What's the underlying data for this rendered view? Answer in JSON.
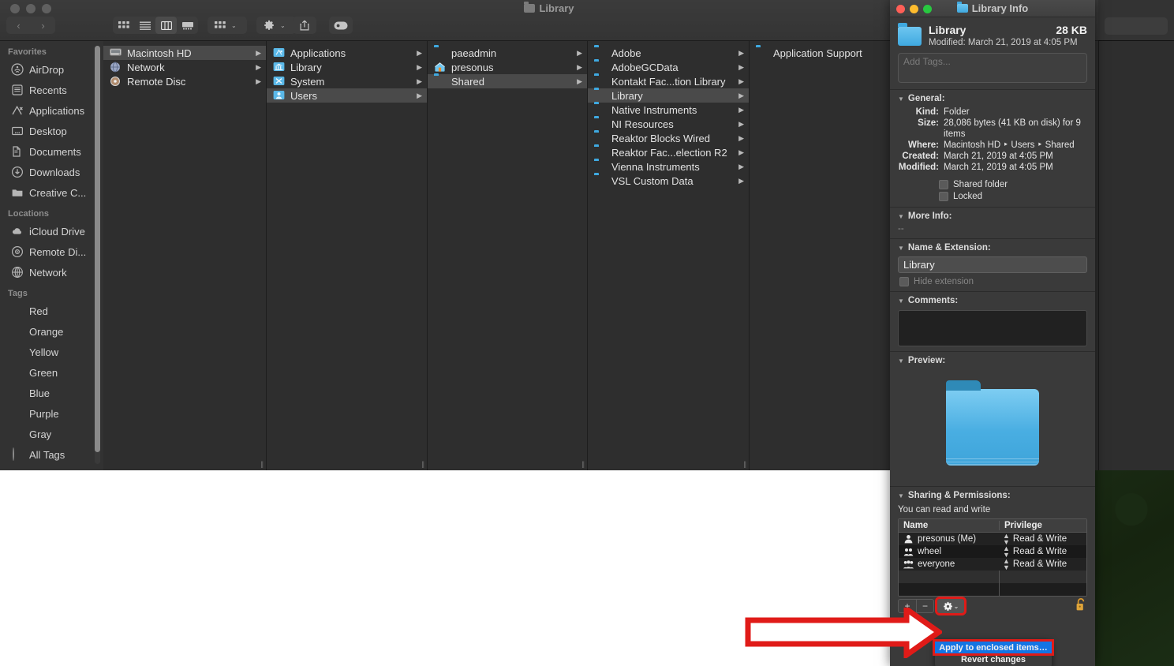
{
  "finder_window": {
    "title": "Library",
    "title_icon": "folder-icon",
    "toolbar": {
      "back_label": "‹",
      "forward_label": "›",
      "view_icon_label": "icon-view-icon",
      "view_list_label": "list-view-icon",
      "view_column_label": "column-view-icon",
      "view_gallery_label": "gallery-view-icon",
      "group_label": "group-by-icon",
      "action_label": "gear-icon",
      "share_label": "share-icon",
      "tags_label": "tag-icon",
      "chevron": "⌄"
    },
    "sidebar": {
      "sections": [
        {
          "header": "Favorites",
          "items": [
            {
              "label": "AirDrop",
              "icon": "airdrop-icon"
            },
            {
              "label": "Recents",
              "icon": "recents-icon"
            },
            {
              "label": "Applications",
              "icon": "applications-icon"
            },
            {
              "label": "Desktop",
              "icon": "desktop-icon"
            },
            {
              "label": "Documents",
              "icon": "documents-icon"
            },
            {
              "label": "Downloads",
              "icon": "downloads-icon"
            },
            {
              "label": "Creative C...",
              "icon": "folder-icon"
            }
          ]
        },
        {
          "header": "Locations",
          "items": [
            {
              "label": "iCloud Drive",
              "icon": "cloud-icon"
            },
            {
              "label": "Remote Di...",
              "icon": "disc-icon"
            },
            {
              "label": "Network",
              "icon": "network-icon"
            }
          ]
        },
        {
          "header": "Tags",
          "items": [
            {
              "label": "Red",
              "icon": "tag-dot-icon",
              "color": "#ff5f57"
            },
            {
              "label": "Orange",
              "icon": "tag-dot-icon",
              "color": "#f5a623"
            },
            {
              "label": "Yellow",
              "icon": "tag-dot-icon",
              "color": "#f5d90a"
            },
            {
              "label": "Green",
              "icon": "tag-dot-icon",
              "color": "#3ddc5b"
            },
            {
              "label": "Blue",
              "icon": "tag-dot-icon",
              "color": "#2f8ef5"
            },
            {
              "label": "Purple",
              "icon": "tag-dot-icon",
              "color": "#d06af5"
            },
            {
              "label": "Gray",
              "icon": "tag-dot-icon",
              "color": "#b0b0b0"
            },
            {
              "label": "All Tags",
              "icon": "all-tags-icon",
              "color": "#808080"
            }
          ]
        }
      ]
    },
    "columns": [
      {
        "name": "column-volumes",
        "items": [
          {
            "label": "Macintosh HD",
            "icon": "harddisk-icon",
            "selected": true,
            "arrow": "▶"
          },
          {
            "label": "Network",
            "icon": "network-globe-icon",
            "selected": false,
            "arrow": "▶"
          },
          {
            "label": "Remote Disc",
            "icon": "disc-icon",
            "selected": false,
            "arrow": "▶"
          }
        ]
      },
      {
        "name": "column-macintosh-hd",
        "items": [
          {
            "label": "Applications",
            "icon": "applications-folder-icon",
            "selected": false,
            "arrow": "▶"
          },
          {
            "label": "Library",
            "icon": "library-folder-icon",
            "selected": false,
            "arrow": "▶"
          },
          {
            "label": "System",
            "icon": "system-folder-icon",
            "selected": false,
            "arrow": "▶"
          },
          {
            "label": "Users",
            "icon": "users-folder-icon",
            "selected": true,
            "arrow": "▶"
          }
        ]
      },
      {
        "name": "column-users",
        "items": [
          {
            "label": "paeadmin",
            "icon": "folder-icon",
            "selected": false,
            "arrow": "▶"
          },
          {
            "label": "presonus",
            "icon": "home-folder-icon",
            "selected": false,
            "arrow": "▶"
          },
          {
            "label": "Shared",
            "icon": "folder-icon",
            "selected": true,
            "arrow": "▶"
          }
        ]
      },
      {
        "name": "column-shared",
        "items": [
          {
            "label": "Adobe",
            "icon": "folder-icon",
            "selected": false,
            "arrow": "▶"
          },
          {
            "label": "AdobeGCData",
            "icon": "folder-icon",
            "selected": false,
            "arrow": "▶"
          },
          {
            "label": "Kontakt Fac...tion Library",
            "icon": "folder-icon",
            "selected": false,
            "arrow": "▶"
          },
          {
            "label": "Library",
            "icon": "folder-icon",
            "selected": true,
            "arrow": "▶"
          },
          {
            "label": "Native Instruments",
            "icon": "folder-icon",
            "selected": false,
            "arrow": "▶"
          },
          {
            "label": "NI Resources",
            "icon": "folder-icon",
            "selected": false,
            "arrow": "▶"
          },
          {
            "label": "Reaktor Blocks Wired",
            "icon": "folder-icon",
            "selected": false,
            "arrow": "▶"
          },
          {
            "label": "Reaktor Fac...election R2",
            "icon": "folder-icon",
            "selected": false,
            "arrow": "▶"
          },
          {
            "label": "Vienna Instruments",
            "icon": "folder-icon",
            "selected": false,
            "arrow": "▶"
          },
          {
            "label": "VSL Custom Data",
            "icon": "folder-icon",
            "selected": false,
            "arrow": "▶"
          }
        ]
      },
      {
        "name": "column-library",
        "items": [
          {
            "label": "Application Support",
            "icon": "folder-icon",
            "selected": false,
            "arrow": ""
          }
        ]
      }
    ],
    "resize_handle": "||"
  },
  "info_window": {
    "title": "Library Info",
    "title_icon": "folder-icon",
    "header": {
      "name": "Library",
      "size": "28 KB",
      "modified": "Modified: March 21, 2019 at 4:05 PM"
    },
    "tags_placeholder": "Add Tags...",
    "general": {
      "title": "General:",
      "rows": [
        {
          "key": "Kind:",
          "value": "Folder"
        },
        {
          "key": "Size:",
          "value": "28,086 bytes (41 KB on disk) for 9 items"
        },
        {
          "key": "Where:",
          "value": "Macintosh HD ‣ Users ‣ Shared"
        },
        {
          "key": "Created:",
          "value": "March 21, 2019 at 4:05 PM"
        },
        {
          "key": "Modified:",
          "value": "March 21, 2019 at 4:05 PM"
        }
      ],
      "checkboxes": [
        {
          "label": "Shared folder",
          "checked": false
        },
        {
          "label": "Locked",
          "checked": false
        }
      ]
    },
    "more_info": {
      "title": "More Info:",
      "value": "--"
    },
    "name_extension": {
      "title": "Name & Extension:",
      "value": "Library",
      "hide_extension_label": "Hide extension",
      "hide_extension_checked": false
    },
    "comments": {
      "title": "Comments:",
      "value": ""
    },
    "preview": {
      "title": "Preview:",
      "icon": "folder-preview-icon"
    },
    "sharing": {
      "title": "Sharing & Permissions:",
      "status": "You can read and write",
      "columns": [
        "Name",
        "Privilege"
      ],
      "rows": [
        {
          "name": "presonus (Me)",
          "icon": "single-user-icon",
          "privilege": "Read & Write"
        },
        {
          "name": "wheel",
          "icon": "group-icon",
          "privilege": "Read & Write"
        },
        {
          "name": "everyone",
          "icon": "everyone-icon",
          "privilege": "Read & Write"
        }
      ],
      "add_label": "+",
      "remove_label": "−",
      "gear_label": "gear-icon",
      "gear_chevron": "⌄",
      "lock_label": "unlocked-lock-icon"
    },
    "context_menu": {
      "items": [
        {
          "label": "Apply to enclosed items…",
          "highlighted": true
        },
        {
          "label": "Revert changes",
          "highlighted": false
        }
      ]
    }
  },
  "annotation": {
    "arrow": "red-arrow-pointing-right",
    "arrow_color": "#e01b18",
    "highlight_color": "#e01b18",
    "selection_color": "#1474e3"
  }
}
